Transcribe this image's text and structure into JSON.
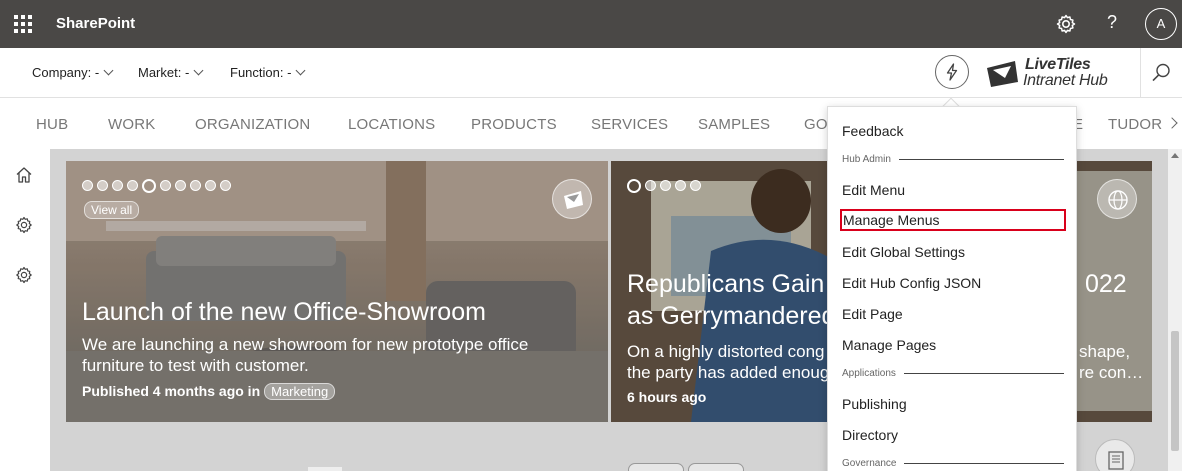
{
  "suitebar": {
    "app_name": "SharePoint",
    "avatar_initial": "A",
    "help_glyph": "?",
    "bg_color": "#4a4846"
  },
  "filters": [
    {
      "label": "Company: -"
    },
    {
      "label": "Market: -"
    },
    {
      "label": "Function: -"
    }
  ],
  "logo": {
    "line1": "LiveTiles",
    "line2": "Intranet Hub"
  },
  "nav": {
    "items": [
      "HUB",
      "WORK",
      "ORGANIZATION",
      "LOCATIONS",
      "PRODUCTS",
      "SERVICES",
      "SAMPLES",
      "GO",
      "E",
      "TUDOR"
    ]
  },
  "cards": [
    {
      "view_all": "View all",
      "title": "Launch of the new Office-Showroom",
      "description": "We are launching a new showroom for new prototype office furniture to test with customer.",
      "meta": "Published 4 months ago in",
      "tag": "Marketing",
      "badge_icon": "mail-icon"
    },
    {
      "title_line1": "Republicans Gain I",
      "title_line1_end": "022",
      "title_line2": "as Gerrymandered",
      "desc_line1": "On a highly distorted cong",
      "desc_line1_end": "shape,",
      "desc_line2": "the party has added enoug",
      "desc_line2_end": "re con…",
      "meta": "6 hours ago",
      "badge_icon": "globe-icon"
    }
  ],
  "menu": {
    "items": [
      {
        "type": "item",
        "label": "Feedback"
      },
      {
        "type": "header",
        "label": "Hub Admin"
      },
      {
        "type": "item",
        "label": "Edit Menu"
      },
      {
        "type": "item",
        "label": "Manage Menus",
        "highlighted": true
      },
      {
        "type": "item",
        "label": "Edit Global Settings"
      },
      {
        "type": "item",
        "label": "Edit Hub Config JSON"
      },
      {
        "type": "item",
        "label": "Edit Page"
      },
      {
        "type": "item",
        "label": "Manage Pages"
      },
      {
        "type": "header",
        "label": "Applications"
      },
      {
        "type": "item",
        "label": "Publishing"
      },
      {
        "type": "item",
        "label": "Directory"
      },
      {
        "type": "header",
        "label": "Governance"
      }
    ],
    "highlight_color": "#d9001b"
  }
}
